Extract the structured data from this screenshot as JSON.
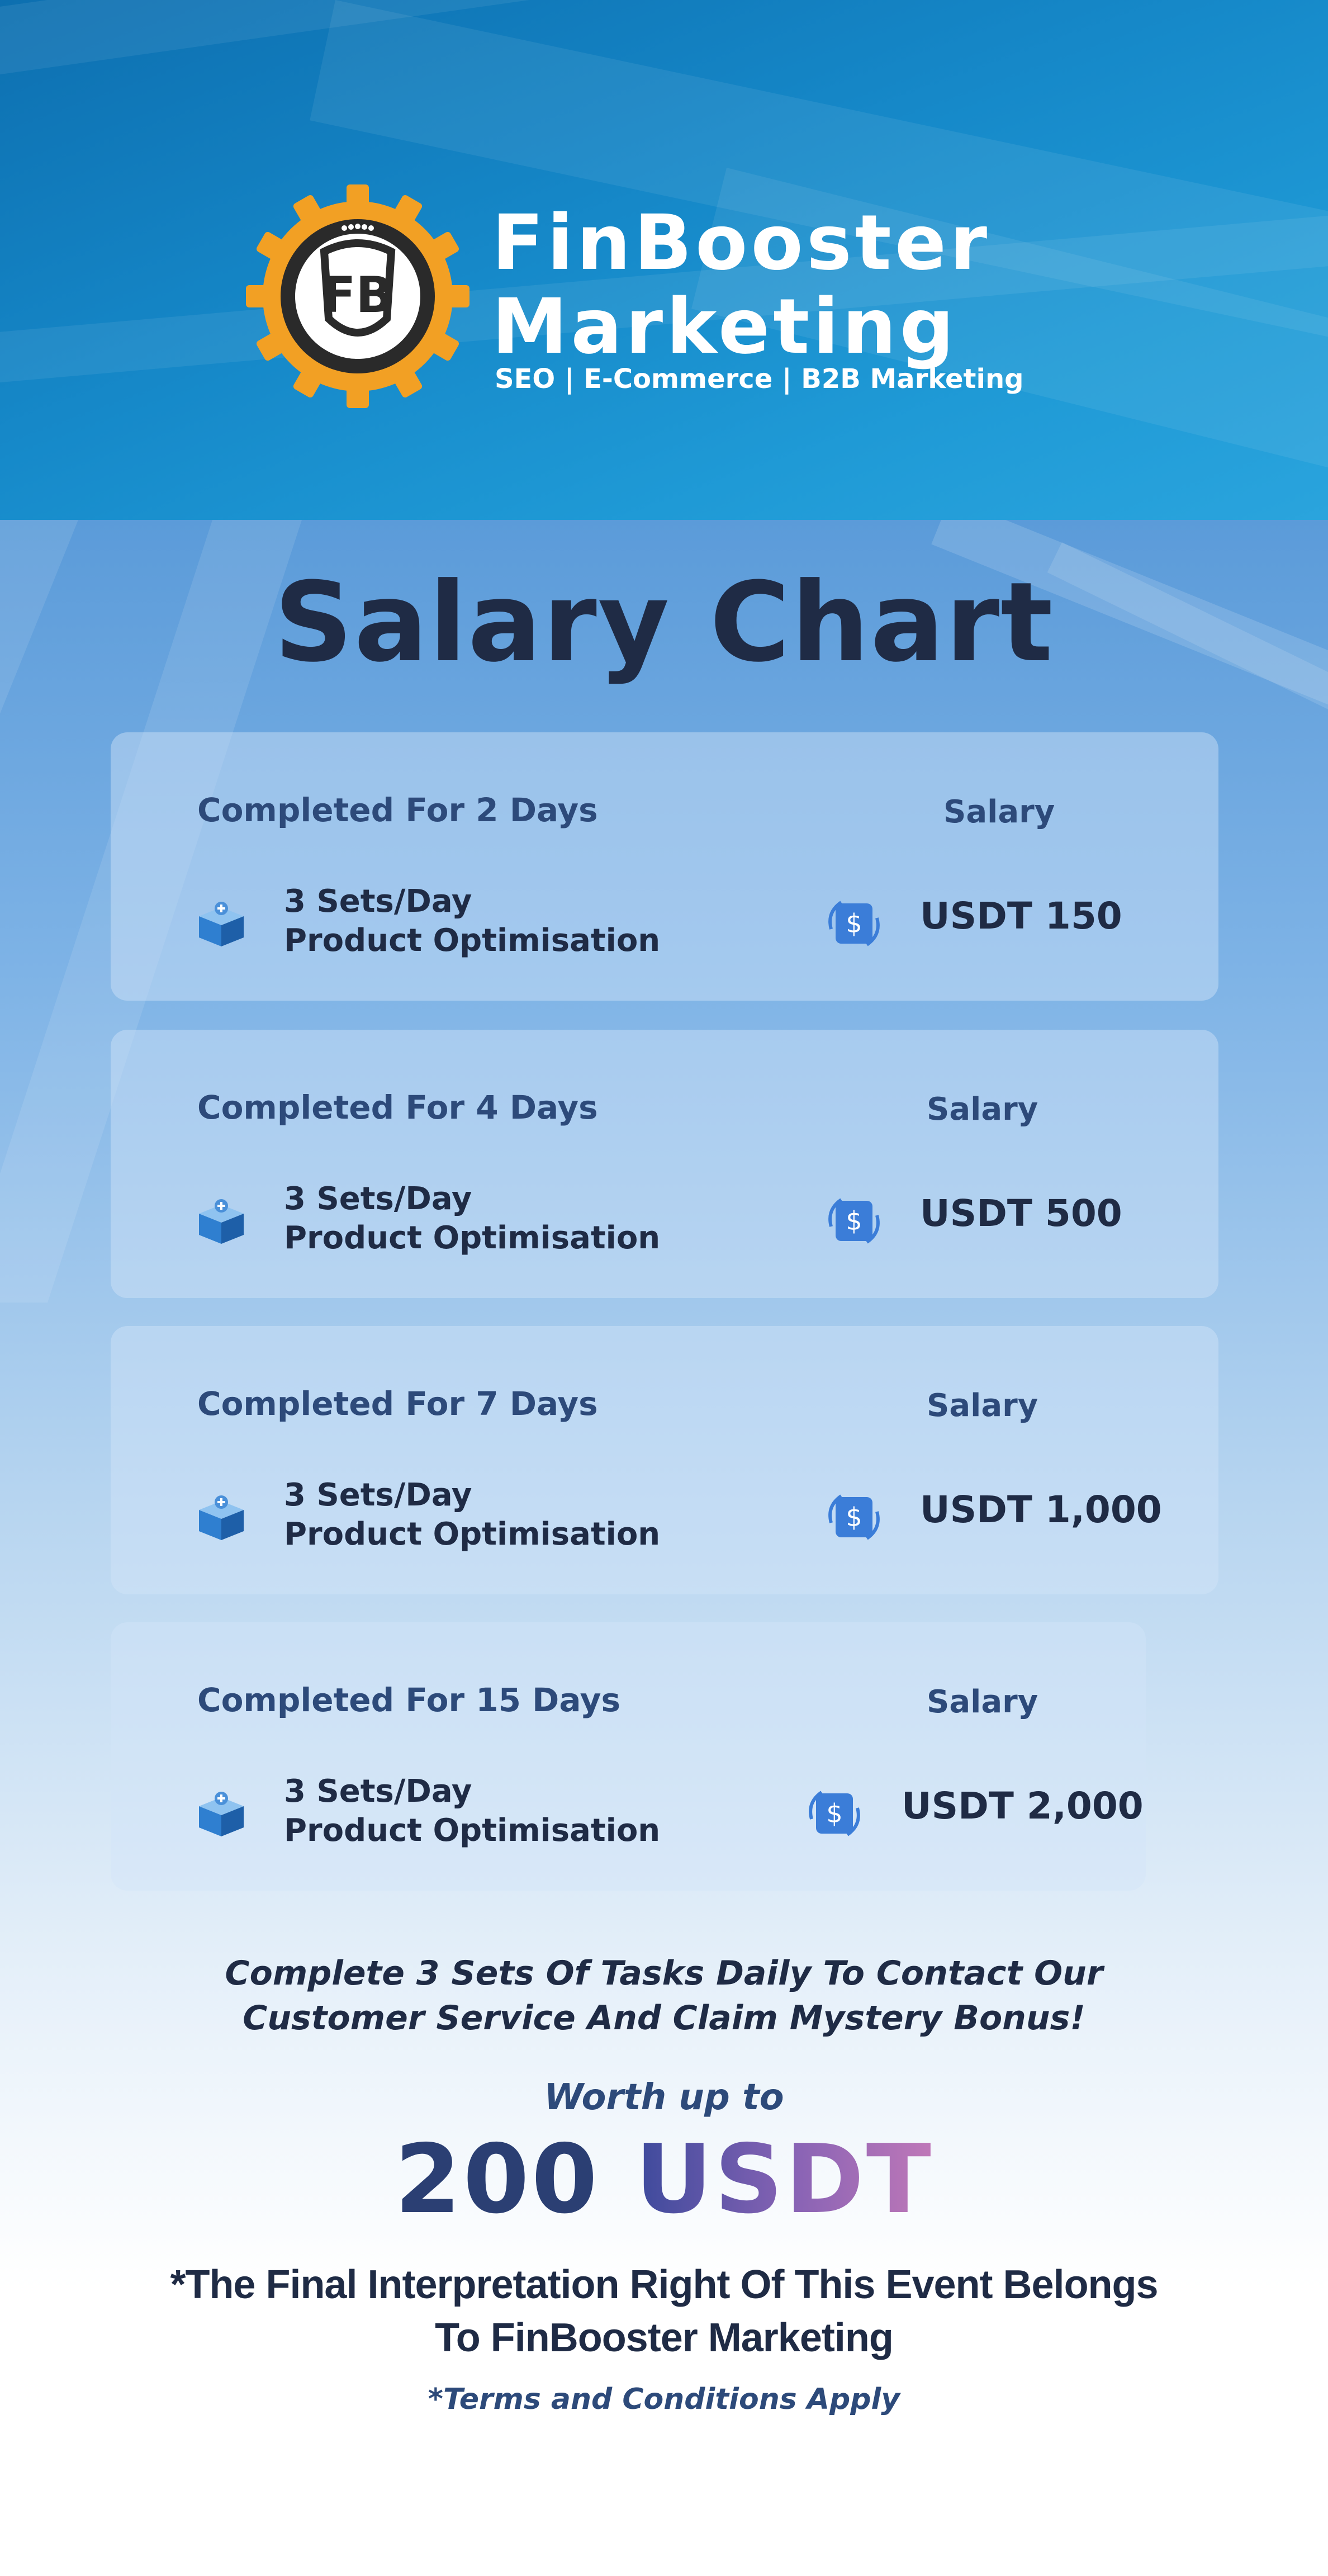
{
  "brand": {
    "logo_letters": "FB",
    "title_line1": "FinBooster",
    "title_line2": "Marketing",
    "tagline": "SEO | E-Commerce | B2B Marketing",
    "colors": {
      "gear": "#f2a024",
      "ring": "#2a2a2a",
      "header": "#1689c9"
    }
  },
  "page_title": "Salary Chart",
  "cards": [
    {
      "days": "Completed For 2 Days",
      "salary_label": "Salary",
      "desc_line1": "3 Sets/Day",
      "desc_line2": "Product Optimisation",
      "amount": "USDT 150",
      "box_icon": "gift-box-icon",
      "money_icon": "dollar-exchange-icon"
    },
    {
      "days": "Completed For 4 Days",
      "salary_label": "Salary",
      "desc_line1": "3 Sets/Day",
      "desc_line2": "Product Optimisation",
      "amount": "USDT 500",
      "box_icon": "gift-box-icon",
      "money_icon": "dollar-exchange-icon"
    },
    {
      "days": "Completed For 7 Days",
      "salary_label": "Salary",
      "desc_line1": "3 Sets/Day",
      "desc_line2": "Product Optimisation",
      "amount": "USDT 1,000",
      "box_icon": "gift-box-icon",
      "money_icon": "dollar-exchange-icon"
    },
    {
      "days": "Completed For 15 Days",
      "salary_label": "Salary",
      "desc_line1": "3 Sets/Day",
      "desc_line2": "Product Optimisation",
      "amount": "USDT 2,000",
      "box_icon": "gift-box-icon",
      "money_icon": "dollar-exchange-icon"
    }
  ],
  "promo": {
    "line1": "Complete 3 Sets Of Tasks Daily To Contact Our",
    "line2": "Customer Service And Claim Mystery Bonus!"
  },
  "bonus": {
    "worth_label": "Worth up to",
    "amount_number": "200",
    "amount_currency": "USDT"
  },
  "disclaimer": {
    "line1": "*The Final Interpretation Right Of This Event Belongs",
    "line2": "To FinBooster Marketing"
  },
  "terms": "*Terms and Conditions Apply"
}
